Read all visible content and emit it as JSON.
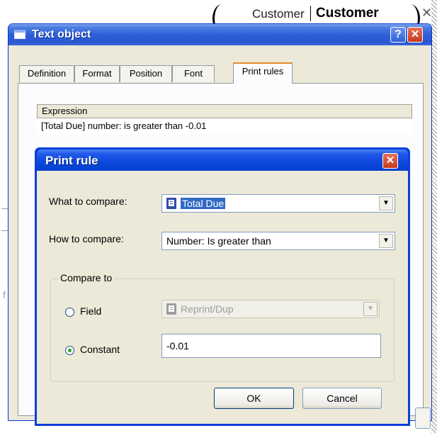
{
  "background": {
    "customer_label": "Customer",
    "customer_value": "Customer",
    "close_glyph": "✕",
    "margin_letter": "f"
  },
  "text_object": {
    "title": "Text object",
    "help_glyph": "?",
    "close_glyph": "✕",
    "tabs": [
      {
        "label": "Definition"
      },
      {
        "label": "Format"
      },
      {
        "label": "Position"
      },
      {
        "label": "Font"
      },
      {
        "label": "Print rules"
      }
    ],
    "active_tab": "Print rules",
    "expression_header": "Expression",
    "expression_text": "[Total Due]  number: is greater than -0.01"
  },
  "print_rule": {
    "title": "Print rule",
    "close_glyph": "✕",
    "what_label": "What to compare:",
    "what_value": "Total Due",
    "how_label": "How to compare:",
    "how_value": "Number: Is greater than",
    "compare_to_legend": "Compare to",
    "field_label": "Field",
    "field_value": "Reprint/Dup",
    "field_checked": false,
    "constant_label": "Constant",
    "constant_value": "-0.01",
    "constant_checked": true,
    "ok_label": "OK",
    "cancel_label": "Cancel",
    "dropdown_glyph": "▼"
  },
  "colors": {
    "xp_title_blue": "#0a48dd",
    "dialog_face": "#ece9d8",
    "selection": "#316ac5",
    "close_red": "#c8391d"
  }
}
